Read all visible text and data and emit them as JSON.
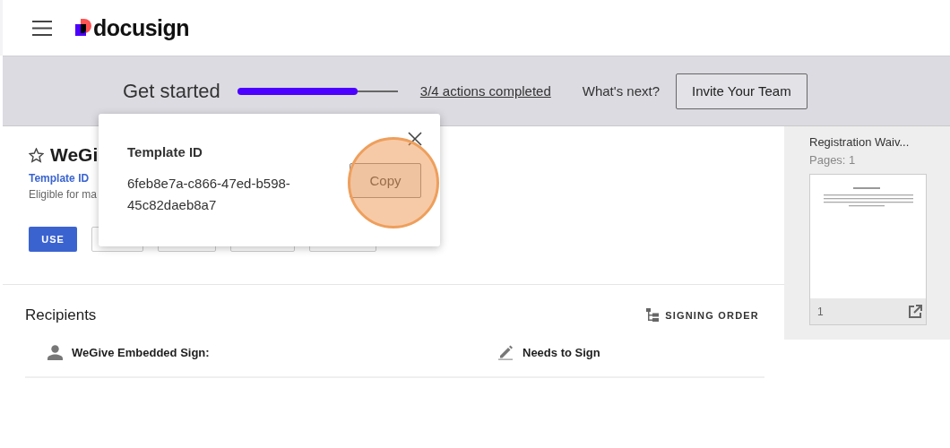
{
  "header": {
    "logo_text": "docusign"
  },
  "banner": {
    "title": "Get started",
    "progress": {
      "level": 0.75
    },
    "progress_link": "3/4 actions completed",
    "next_label": "What's next?",
    "invite_button": "Invite Your Team"
  },
  "template": {
    "starred": false,
    "title": "WeGi",
    "id_link": "Template ID",
    "eligibility": "Eligible for ma",
    "use_button": "USE",
    "action_buttons": [
      {
        "kind": "blank"
      },
      {
        "kind": "blank"
      },
      {
        "kind": "blank"
      },
      {
        "kind": "blank"
      }
    ]
  },
  "popover": {
    "title": "Template ID",
    "id_value": "6feb8e7a-c866-47ed-b598-45c82daeb8a7",
    "copy_button": "Copy",
    "highlighted": true
  },
  "recipients": {
    "title": "Recipients",
    "signing_order_button": "SIGNING ORDER",
    "rows": [
      {
        "name": "WeGive Embedded Sign:",
        "action": "Needs to Sign"
      }
    ]
  },
  "document": {
    "name": "Registration Waiv...",
    "pages": "Pages: 1",
    "page_number": "1"
  }
}
